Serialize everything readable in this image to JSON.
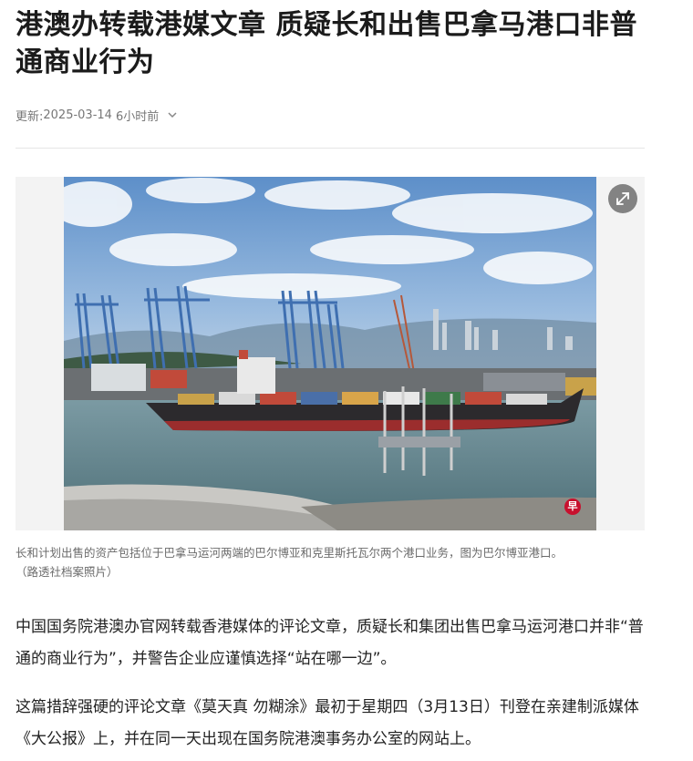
{
  "article": {
    "headline": "港澳办转载港媒文章 质疑长和出售巴拿马港口非普通商业行为",
    "meta": {
      "prefix": "更新: ",
      "date": "2025-03-14",
      "relative": "6小时前"
    },
    "figure": {
      "caption_line1": "长和计划出售的资产包括位于巴拿马运河两端的巴尔博亚和克里斯托瓦尔两个港口业务，图为巴尔博亚港口。",
      "caption_line2": "（路透社档案照片）",
      "watermark": "早"
    },
    "paragraphs": [
      "中国国务院港澳办官网转载香港媒体的评论文章，质疑长和集团出售巴拿马运河港口并非“普通的商业行为”，并警告企业应谨慎选择“站在哪一边”。",
      "这篇措辞强硬的评论文章《莫天真 勿糊涂》最初于星期四（3月13日）刊登在亲建制派媒体《大公报》上，并在同一天出现在国务院港澳事务办公室的网站上。"
    ]
  },
  "icons": {
    "expand": "expand-icon",
    "chevron": "chevron-down-icon"
  },
  "colors": {
    "text": "#1b1b1b",
    "meta": "#777777",
    "caption": "#6b6b6b",
    "brand_badge": "#c8102e"
  }
}
